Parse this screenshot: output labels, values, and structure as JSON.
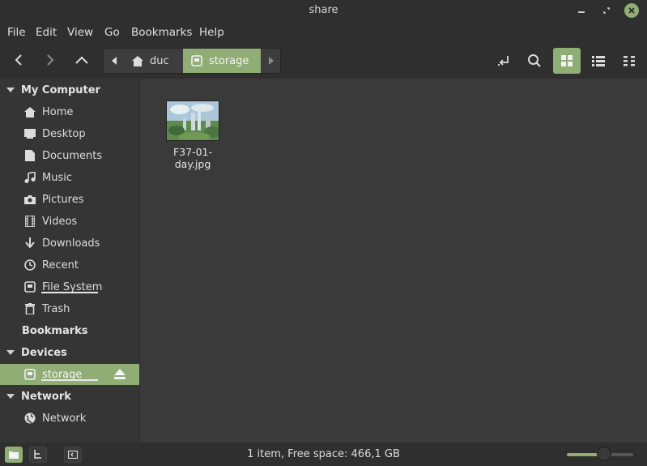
{
  "window": {
    "title": "share"
  },
  "menubar": {
    "items": [
      "File",
      "Edit",
      "View",
      "Go",
      "Bookmarks",
      "Help"
    ]
  },
  "breadcrumbs": [
    {
      "label": "duc",
      "icon": "home-icon"
    },
    {
      "label": "storage",
      "icon": "drive-icon",
      "active": true
    }
  ],
  "toolbar": {
    "view_mode": "icons",
    "buttons": [
      "back",
      "forward",
      "up",
      "toggle-location",
      "search",
      "icon-view",
      "list-view",
      "compact-view"
    ]
  },
  "sidebar": {
    "my_computer": {
      "title": "My Computer",
      "items": [
        {
          "label": "Home",
          "icon": "home-icon"
        },
        {
          "label": "Desktop",
          "icon": "desktop-icon"
        },
        {
          "label": "Documents",
          "icon": "document-icon"
        },
        {
          "label": "Music",
          "icon": "music-icon"
        },
        {
          "label": "Pictures",
          "icon": "camera-icon"
        },
        {
          "label": "Videos",
          "icon": "film-icon"
        },
        {
          "label": "Downloads",
          "icon": "download-icon"
        },
        {
          "label": "Recent",
          "icon": "clock-icon"
        },
        {
          "label": "File System",
          "icon": "drive-icon"
        },
        {
          "label": "Trash",
          "icon": "trash-icon"
        }
      ]
    },
    "bookmarks": {
      "title": "Bookmarks"
    },
    "devices": {
      "title": "Devices",
      "items": [
        {
          "label": "storage",
          "icon": "drive-icon",
          "selected": true
        }
      ]
    },
    "network": {
      "title": "Network",
      "items": [
        {
          "label": "Network",
          "icon": "globe-icon"
        }
      ]
    }
  },
  "files": [
    {
      "name": "F37-01-day.jpg",
      "type": "image-thumbnail"
    }
  ],
  "status": {
    "text": "1 item, Free space: 466,1 GB",
    "zoom_level": 0.56
  },
  "colors": {
    "accent": "#8fad75",
    "sidebar_bg": "#353535",
    "main_bg": "#3a3a3a",
    "chrome_bg": "#2f2f2f"
  }
}
